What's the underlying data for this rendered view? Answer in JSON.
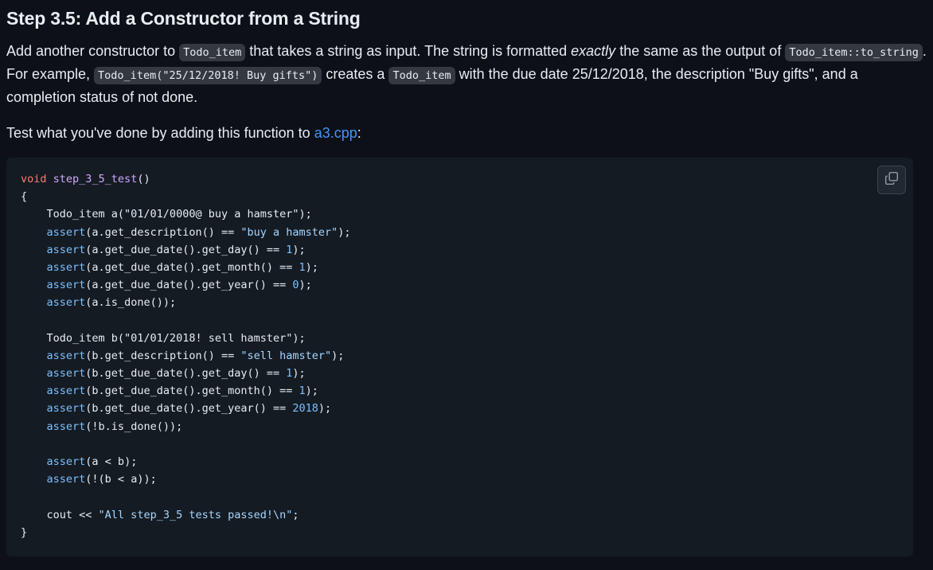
{
  "heading": "Step 3.5: Add a Constructor from a String",
  "paragraph1": {
    "t1": "Add another constructor to ",
    "c1": "Todo_item",
    "t2": " that takes a string as input. The string is formatted ",
    "em": "exactly",
    "t3": " the same as the output of ",
    "c2": "Todo_item::to_string",
    "t4": ". For example, ",
    "c3": "Todo_item(\"25/12/2018! Buy gifts\")",
    "t5": " creates a ",
    "c4": "Todo_item",
    "t6": " with the due date 25/12/2018, the description \"Buy gifts\", and a completion status of not done."
  },
  "paragraph2": {
    "text": "Test what you've done by adding this function to ",
    "link": "a3.cpp",
    "after": ":"
  },
  "code": {
    "copy_icon": "copy-icon",
    "lines": [
      [
        [
          "kw",
          "void"
        ],
        [
          "t",
          " "
        ],
        [
          "fn",
          "step_3_5_test"
        ],
        [
          "t",
          "()"
        ]
      ],
      [
        [
          "t",
          "{"
        ]
      ],
      [
        [
          "t",
          "    Todo_item a(\"01/01/0000@ buy a hamster\");"
        ]
      ],
      [
        [
          "t",
          "    "
        ],
        [
          "call",
          "assert"
        ],
        [
          "t",
          "(a.get_description() == "
        ],
        [
          "str",
          "\"buy a hamster\""
        ],
        [
          "t",
          ");"
        ]
      ],
      [
        [
          "t",
          "    "
        ],
        [
          "call",
          "assert"
        ],
        [
          "t",
          "(a.get_due_date().get_day() == "
        ],
        [
          "num",
          "1"
        ],
        [
          "t",
          ");"
        ]
      ],
      [
        [
          "t",
          "    "
        ],
        [
          "call",
          "assert"
        ],
        [
          "t",
          "(a.get_due_date().get_month() == "
        ],
        [
          "num",
          "1"
        ],
        [
          "t",
          ");"
        ]
      ],
      [
        [
          "t",
          "    "
        ],
        [
          "call",
          "assert"
        ],
        [
          "t",
          "(a.get_due_date().get_year() == "
        ],
        [
          "num",
          "0"
        ],
        [
          "t",
          ");"
        ]
      ],
      [
        [
          "t",
          "    "
        ],
        [
          "call",
          "assert"
        ],
        [
          "t",
          "(a.is_done());"
        ]
      ],
      [],
      [
        [
          "t",
          "    Todo_item b(\"01/01/2018! sell hamster\");"
        ]
      ],
      [
        [
          "t",
          "    "
        ],
        [
          "call",
          "assert"
        ],
        [
          "t",
          "(b.get_description() == "
        ],
        [
          "str",
          "\"sell hamster\""
        ],
        [
          "t",
          ");"
        ]
      ],
      [
        [
          "t",
          "    "
        ],
        [
          "call",
          "assert"
        ],
        [
          "t",
          "(b.get_due_date().get_day() == "
        ],
        [
          "num",
          "1"
        ],
        [
          "t",
          ");"
        ]
      ],
      [
        [
          "t",
          "    "
        ],
        [
          "call",
          "assert"
        ],
        [
          "t",
          "(b.get_due_date().get_month() == "
        ],
        [
          "num",
          "1"
        ],
        [
          "t",
          ");"
        ]
      ],
      [
        [
          "t",
          "    "
        ],
        [
          "call",
          "assert"
        ],
        [
          "t",
          "(b.get_due_date().get_year() == "
        ],
        [
          "num",
          "2018"
        ],
        [
          "t",
          ");"
        ]
      ],
      [
        [
          "t",
          "    "
        ],
        [
          "call",
          "assert"
        ],
        [
          "t",
          "(!b.is_done());"
        ]
      ],
      [],
      [
        [
          "t",
          "    "
        ],
        [
          "call",
          "assert"
        ],
        [
          "t",
          "(a < b);"
        ]
      ],
      [
        [
          "t",
          "    "
        ],
        [
          "call",
          "assert"
        ],
        [
          "t",
          "(!(b < a));"
        ]
      ],
      [],
      [
        [
          "t",
          "    cout << "
        ],
        [
          "str",
          "\"All step_3_5 tests passed!\\n\""
        ],
        [
          "t",
          ";"
        ]
      ],
      [
        [
          "t",
          "}"
        ]
      ]
    ]
  }
}
